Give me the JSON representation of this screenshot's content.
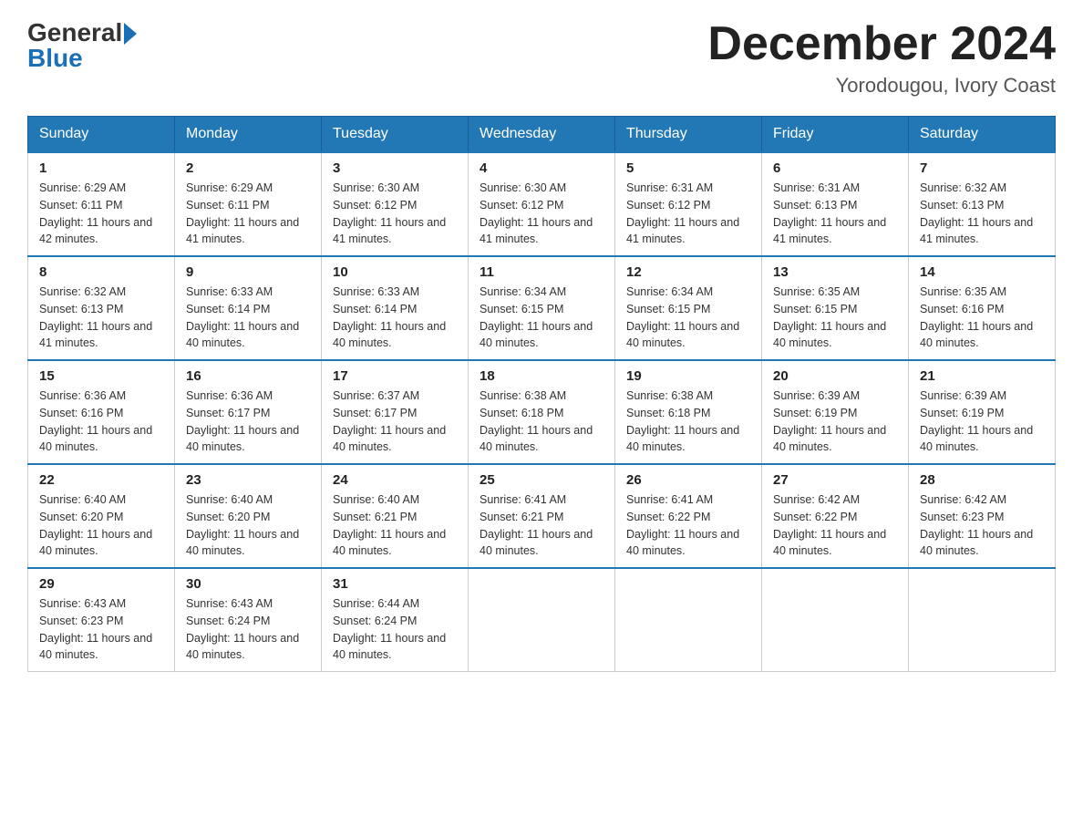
{
  "header": {
    "logo_general": "General",
    "logo_blue": "Blue",
    "month_year": "December 2024",
    "location": "Yorodougou, Ivory Coast"
  },
  "days_of_week": [
    "Sunday",
    "Monday",
    "Tuesday",
    "Wednesday",
    "Thursday",
    "Friday",
    "Saturday"
  ],
  "weeks": [
    [
      {
        "day": "1",
        "sunrise": "6:29 AM",
        "sunset": "6:11 PM",
        "daylight": "11 hours and 42 minutes."
      },
      {
        "day": "2",
        "sunrise": "6:29 AM",
        "sunset": "6:11 PM",
        "daylight": "11 hours and 41 minutes."
      },
      {
        "day": "3",
        "sunrise": "6:30 AM",
        "sunset": "6:12 PM",
        "daylight": "11 hours and 41 minutes."
      },
      {
        "day": "4",
        "sunrise": "6:30 AM",
        "sunset": "6:12 PM",
        "daylight": "11 hours and 41 minutes."
      },
      {
        "day": "5",
        "sunrise": "6:31 AM",
        "sunset": "6:12 PM",
        "daylight": "11 hours and 41 minutes."
      },
      {
        "day": "6",
        "sunrise": "6:31 AM",
        "sunset": "6:13 PM",
        "daylight": "11 hours and 41 minutes."
      },
      {
        "day": "7",
        "sunrise": "6:32 AM",
        "sunset": "6:13 PM",
        "daylight": "11 hours and 41 minutes."
      }
    ],
    [
      {
        "day": "8",
        "sunrise": "6:32 AM",
        "sunset": "6:13 PM",
        "daylight": "11 hours and 41 minutes."
      },
      {
        "day": "9",
        "sunrise": "6:33 AM",
        "sunset": "6:14 PM",
        "daylight": "11 hours and 40 minutes."
      },
      {
        "day": "10",
        "sunrise": "6:33 AM",
        "sunset": "6:14 PM",
        "daylight": "11 hours and 40 minutes."
      },
      {
        "day": "11",
        "sunrise": "6:34 AM",
        "sunset": "6:15 PM",
        "daylight": "11 hours and 40 minutes."
      },
      {
        "day": "12",
        "sunrise": "6:34 AM",
        "sunset": "6:15 PM",
        "daylight": "11 hours and 40 minutes."
      },
      {
        "day": "13",
        "sunrise": "6:35 AM",
        "sunset": "6:15 PM",
        "daylight": "11 hours and 40 minutes."
      },
      {
        "day": "14",
        "sunrise": "6:35 AM",
        "sunset": "6:16 PM",
        "daylight": "11 hours and 40 minutes."
      }
    ],
    [
      {
        "day": "15",
        "sunrise": "6:36 AM",
        "sunset": "6:16 PM",
        "daylight": "11 hours and 40 minutes."
      },
      {
        "day": "16",
        "sunrise": "6:36 AM",
        "sunset": "6:17 PM",
        "daylight": "11 hours and 40 minutes."
      },
      {
        "day": "17",
        "sunrise": "6:37 AM",
        "sunset": "6:17 PM",
        "daylight": "11 hours and 40 minutes."
      },
      {
        "day": "18",
        "sunrise": "6:38 AM",
        "sunset": "6:18 PM",
        "daylight": "11 hours and 40 minutes."
      },
      {
        "day": "19",
        "sunrise": "6:38 AM",
        "sunset": "6:18 PM",
        "daylight": "11 hours and 40 minutes."
      },
      {
        "day": "20",
        "sunrise": "6:39 AM",
        "sunset": "6:19 PM",
        "daylight": "11 hours and 40 minutes."
      },
      {
        "day": "21",
        "sunrise": "6:39 AM",
        "sunset": "6:19 PM",
        "daylight": "11 hours and 40 minutes."
      }
    ],
    [
      {
        "day": "22",
        "sunrise": "6:40 AM",
        "sunset": "6:20 PM",
        "daylight": "11 hours and 40 minutes."
      },
      {
        "day": "23",
        "sunrise": "6:40 AM",
        "sunset": "6:20 PM",
        "daylight": "11 hours and 40 minutes."
      },
      {
        "day": "24",
        "sunrise": "6:40 AM",
        "sunset": "6:21 PM",
        "daylight": "11 hours and 40 minutes."
      },
      {
        "day": "25",
        "sunrise": "6:41 AM",
        "sunset": "6:21 PM",
        "daylight": "11 hours and 40 minutes."
      },
      {
        "day": "26",
        "sunrise": "6:41 AM",
        "sunset": "6:22 PM",
        "daylight": "11 hours and 40 minutes."
      },
      {
        "day": "27",
        "sunrise": "6:42 AM",
        "sunset": "6:22 PM",
        "daylight": "11 hours and 40 minutes."
      },
      {
        "day": "28",
        "sunrise": "6:42 AM",
        "sunset": "6:23 PM",
        "daylight": "11 hours and 40 minutes."
      }
    ],
    [
      {
        "day": "29",
        "sunrise": "6:43 AM",
        "sunset": "6:23 PM",
        "daylight": "11 hours and 40 minutes."
      },
      {
        "day": "30",
        "sunrise": "6:43 AM",
        "sunset": "6:24 PM",
        "daylight": "11 hours and 40 minutes."
      },
      {
        "day": "31",
        "sunrise": "6:44 AM",
        "sunset": "6:24 PM",
        "daylight": "11 hours and 40 minutes."
      },
      null,
      null,
      null,
      null
    ]
  ]
}
